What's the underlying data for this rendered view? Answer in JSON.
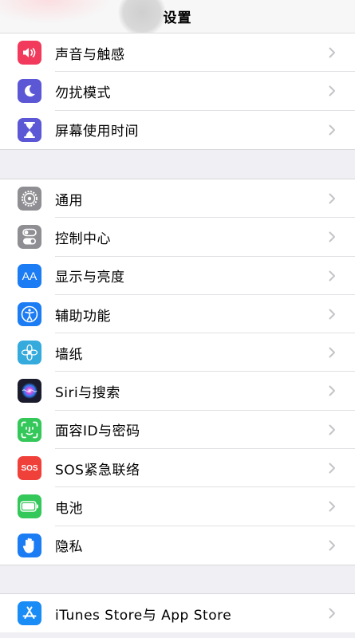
{
  "nav": {
    "title": "设置"
  },
  "colors": {
    "sounds": "#f23a5c",
    "dnd": "#5b57d5",
    "screentime": "#5b57d5",
    "general": "#8e8e93",
    "control": "#8e8e93",
    "display": "#1c7cf4",
    "accessibility": "#1c7cf4",
    "wallpaper": "#35aadc",
    "siri": "#1b1b2e",
    "faceid": "#34c759",
    "sos": "#f0403a",
    "battery": "#34c759",
    "privacy": "#1c7cf4",
    "appstore": "#1a8cf6"
  },
  "group1": [
    {
      "id": "sounds",
      "label": "声音与触感",
      "icon": "speaker-icon"
    },
    {
      "id": "dnd",
      "label": "勿扰模式",
      "icon": "moon-icon"
    },
    {
      "id": "screentime",
      "label": "屏幕使用时间",
      "icon": "hourglass-icon"
    }
  ],
  "group2": [
    {
      "id": "general",
      "label": "通用",
      "icon": "gear-icon"
    },
    {
      "id": "control",
      "label": "控制中心",
      "icon": "toggles-icon"
    },
    {
      "id": "display",
      "label": "显示与亮度",
      "icon": "text-size-icon",
      "icon_text": "AA"
    },
    {
      "id": "accessibility",
      "label": "辅助功能",
      "icon": "accessibility-icon"
    },
    {
      "id": "wallpaper",
      "label": "墙纸",
      "icon": "flower-icon"
    },
    {
      "id": "siri",
      "label": "Siri与搜索",
      "icon": "siri-icon"
    },
    {
      "id": "faceid",
      "label": "面容ID与密码",
      "icon": "face-id-icon"
    },
    {
      "id": "sos",
      "label": "SOS紧急联络",
      "icon": "sos-icon",
      "icon_text": "SOS"
    },
    {
      "id": "battery",
      "label": "电池",
      "icon": "battery-icon"
    },
    {
      "id": "privacy",
      "label": "隐私",
      "icon": "hand-icon"
    }
  ],
  "group3": [
    {
      "id": "appstore",
      "label": "iTunes Store与 App Store",
      "icon": "app-store-icon"
    }
  ]
}
